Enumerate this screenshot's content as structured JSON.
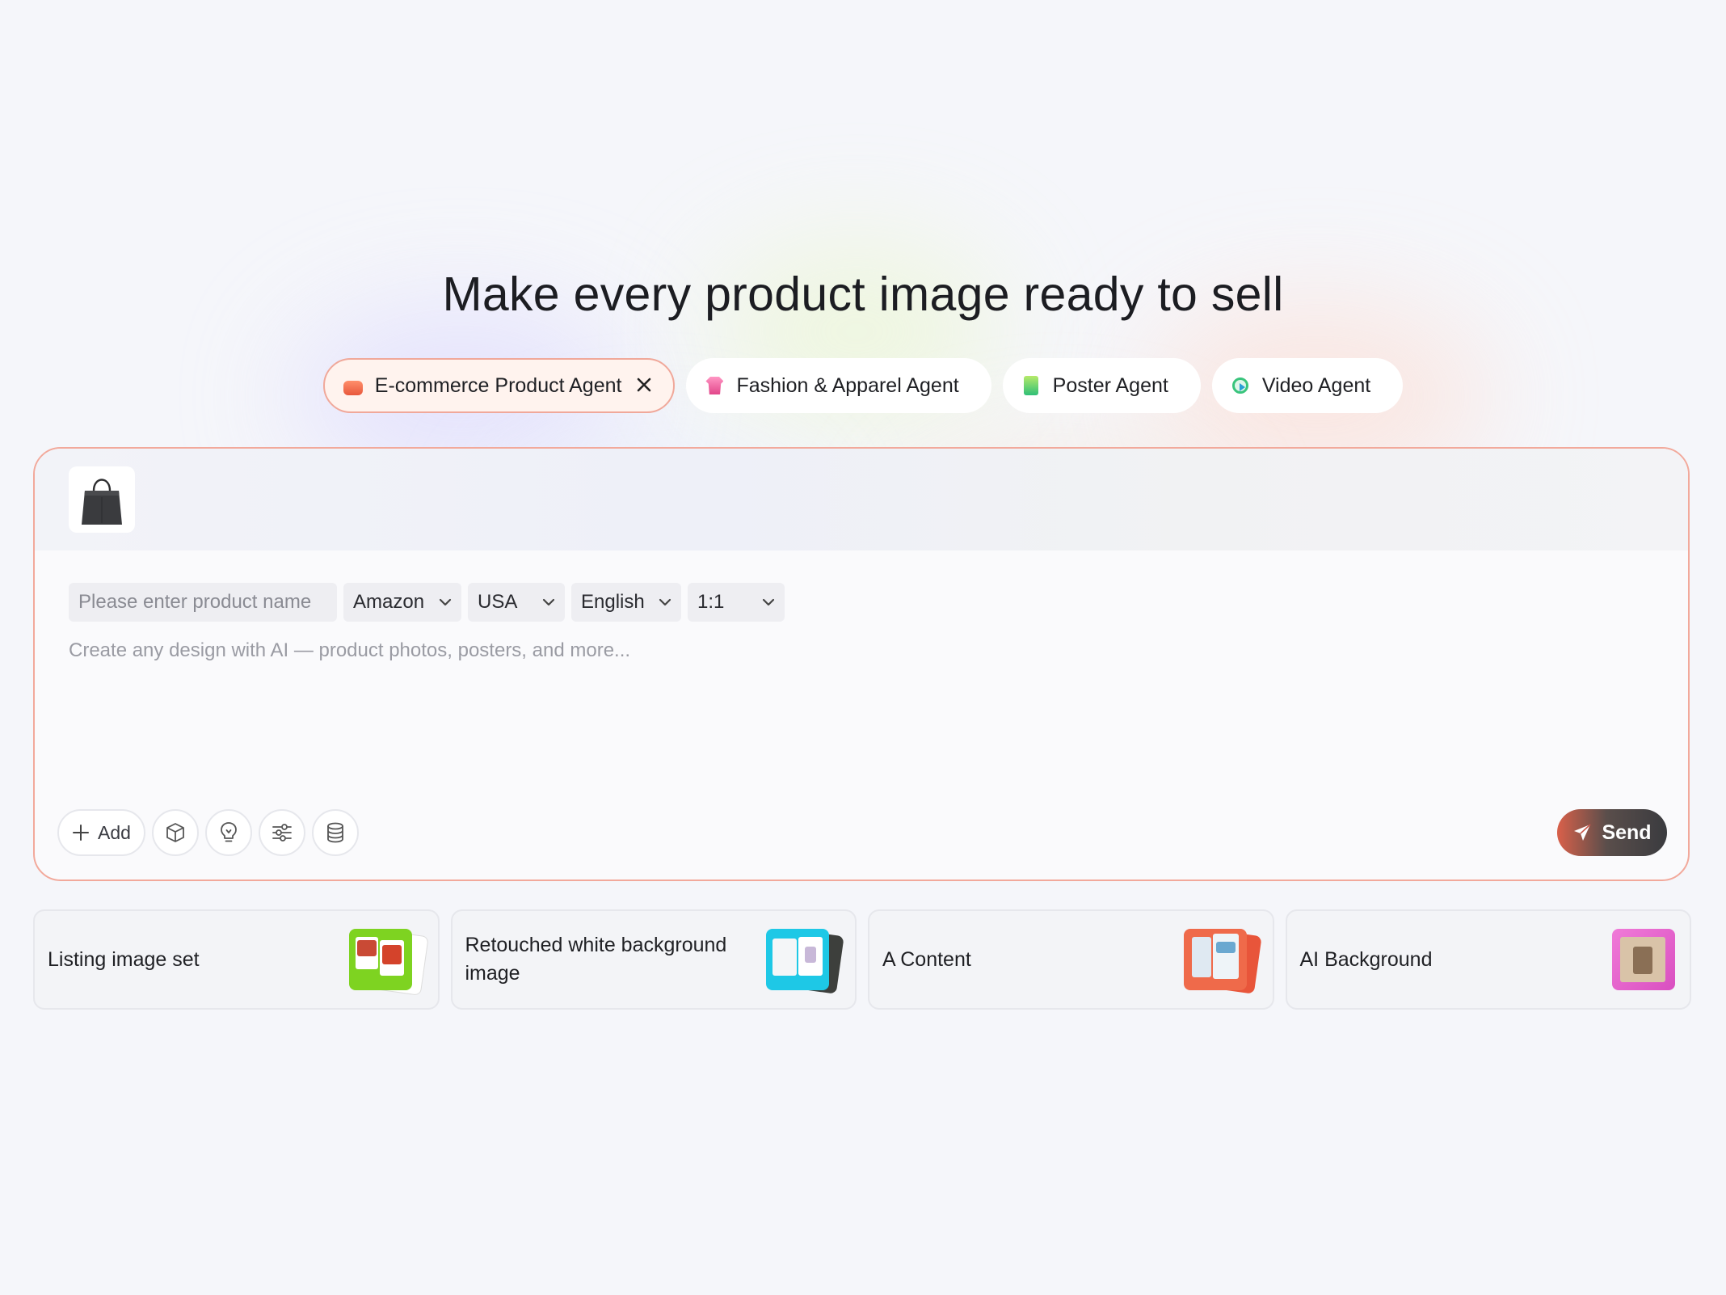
{
  "headline": "Make every product image ready to sell",
  "agent_tabs": [
    {
      "label": "E-commerce Product Agent",
      "icon": "sofa-icon",
      "active": true
    },
    {
      "label": "Fashion & Apparel Agent",
      "icon": "shirt-icon",
      "active": false
    },
    {
      "label": "Poster Agent",
      "icon": "poster-icon",
      "active": false
    },
    {
      "label": "Video Agent",
      "icon": "video-icon",
      "active": false
    }
  ],
  "composer": {
    "attachment_icon": "handbag-icon",
    "product_name_placeholder": "Please enter product name",
    "platform": "Amazon",
    "region": "USA",
    "language": "English",
    "aspect_ratio": "1:1",
    "prompt_placeholder": "Create any design with AI — product photos, posters, and more...",
    "add_label": "Add",
    "tool_icons": [
      "cube-icon",
      "lightbulb-icon",
      "sliders-icon",
      "database-icon"
    ],
    "send_label": "Send"
  },
  "cards": [
    {
      "label": "Listing image set",
      "accent": "#7ed321"
    },
    {
      "label": "Retouched white background image",
      "accent": "#1ec8e6"
    },
    {
      "label": "A Content",
      "accent": "#e8553a"
    },
    {
      "label": "AI Background",
      "accent": "#e85fc8"
    }
  ],
  "colors": {
    "accent_border": "#f2a99b",
    "send_start": "#d9604a",
    "send_end": "#3a3b3f",
    "background": "#f5f6fa"
  }
}
